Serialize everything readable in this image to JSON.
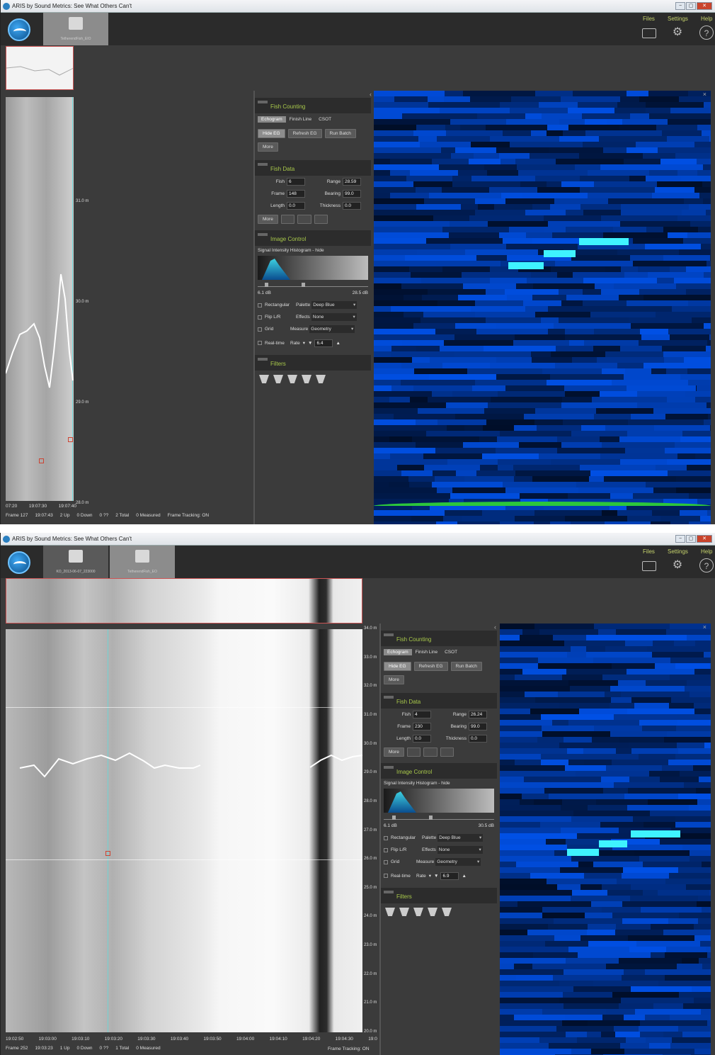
{
  "window": {
    "title": "ARIS by Sound Metrics: See What Others Can't",
    "btn_min": "−",
    "btn_max": "▢",
    "btn_close": "✕"
  },
  "topbar": {
    "files": "Files",
    "settings": "Settings",
    "help": "Help",
    "help_icon": "?",
    "settings_icon": "⚙"
  },
  "colors": {
    "accent_green": "#a8c84a",
    "sonar_bright": "#3ff3ff",
    "bottom_line": "#2cc63c",
    "marker": "#cc4433"
  },
  "panel": {
    "fish_counting": "Fish Counting",
    "tabs": [
      "Echogram",
      "Finish Line",
      "CSOT"
    ],
    "hide_eg": "Hide EG",
    "refresh_eg": "Refresh EG",
    "run_batch": "Run Batch",
    "more": "More",
    "fish_data": "Fish Data",
    "fish_label": "Fish",
    "frame_label": "Frame",
    "length_label": "Length",
    "range_label": "Range",
    "bearing_label": "Bearing",
    "thickness_label": "Thickness",
    "image_control": "Image Control",
    "histogram": "Signal Intensity Histogram - hide",
    "rectangular": "Rectangular",
    "flip": "Flip L/R",
    "grid": "Grid",
    "palette_label": "Palette",
    "palette_value": "Deep Blue",
    "effects_label": "Effects",
    "effects_value": "None",
    "measure_label": "Measure",
    "measure_value": "Geometry",
    "realtime": "Real-time",
    "rate_label": "Rate",
    "filters": "Filters"
  },
  "screen1": {
    "tab_active": "TetherendFish_EIO",
    "fish": "6",
    "frame": "148",
    "length": "0.0",
    "range": "28.59",
    "bearing": "99.0",
    "thickness": "0.0",
    "db_min": "6.1 dB",
    "db_max": "28.5 dB",
    "rate": "6.4",
    "range_labels": [
      "31.0 m",
      "30.0 m",
      "29.0 m",
      "28.0 m"
    ],
    "time_labels": [
      "07:20",
      "19:07:30",
      "19:07:40"
    ],
    "status": [
      "Frame 127",
      "19:07:43",
      "2 Up",
      "0 Down",
      "0 ??",
      "2 Total",
      "0 Measured",
      "Frame Tracking: ON"
    ]
  },
  "screen2": {
    "tab_1": "KO_2013-06-07_223000",
    "tab_active": "TetherendFish_EO",
    "fish": "4",
    "frame": "230",
    "length": "0.0",
    "range": "26.24",
    "bearing": "99.0",
    "thickness": "0.0",
    "db_min": "6.1 dB",
    "db_max": "30.5 dB",
    "rate": "6.9",
    "range_labels": [
      "34.0 m",
      "33.0 m",
      "32.0 m",
      "31.0 m",
      "30.0 m",
      "29.0 m",
      "28.0 m",
      "27.0 m",
      "26.0 m",
      "25.0 m",
      "24.0 m",
      "23.0 m",
      "22.0 m",
      "21.0 m",
      "20.0 m"
    ],
    "time_labels": [
      "19:02:50",
      "19:03:00",
      "19:03:10",
      "19:03:20",
      "19:03:30",
      "19:03:40",
      "19:03:50",
      "19:04:00",
      "19:04:10",
      "19:04:20",
      "19:04:30",
      "19:0"
    ],
    "status": [
      "Frame 252",
      "19:03:23",
      "1 Up",
      "0 Down",
      "0 ??",
      "1 Total",
      "0 Measured"
    ],
    "frame_tracking": "Frame Tracking: ON"
  }
}
